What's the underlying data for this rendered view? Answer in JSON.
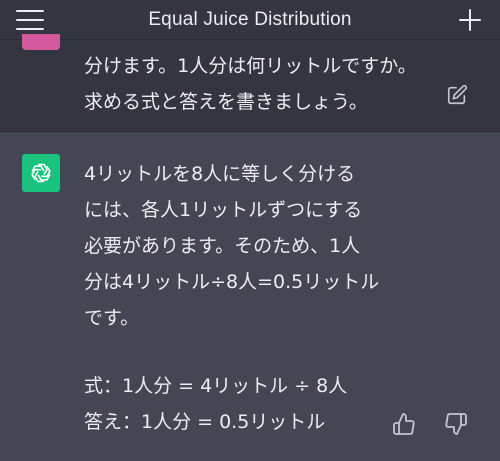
{
  "header": {
    "title": "Equal Juice Distribution",
    "menu_icon": "hamburger-menu-icon",
    "new_chat_icon": "plus-icon"
  },
  "user_message": {
    "lines": [
      "分けます。1人分は何リットルですか。",
      "求める式と答えを書きましょう。"
    ],
    "edit_icon": "pencil-edit-icon"
  },
  "assistant_message": {
    "lines": [
      "4リットルを8人に等しく分ける",
      "には、各人1リットルずつにする",
      "必要があります。そのため、1人",
      "分は4リットル÷8人=0.5リットル",
      "です。"
    ],
    "formula": "式：1人分 = 4リットル ÷ 8人",
    "answer": "答え：1人分 = 0.5リットル",
    "thumbs_up_icon": "thumbs-up-icon",
    "thumbs_down_icon": "thumbs-down-icon"
  },
  "colors": {
    "header_bg": "#343541",
    "assistant_bg": "#444654",
    "assistant_avatar": "#19c37d",
    "user_avatar": "#d35b9d",
    "text": "#ececf1"
  }
}
